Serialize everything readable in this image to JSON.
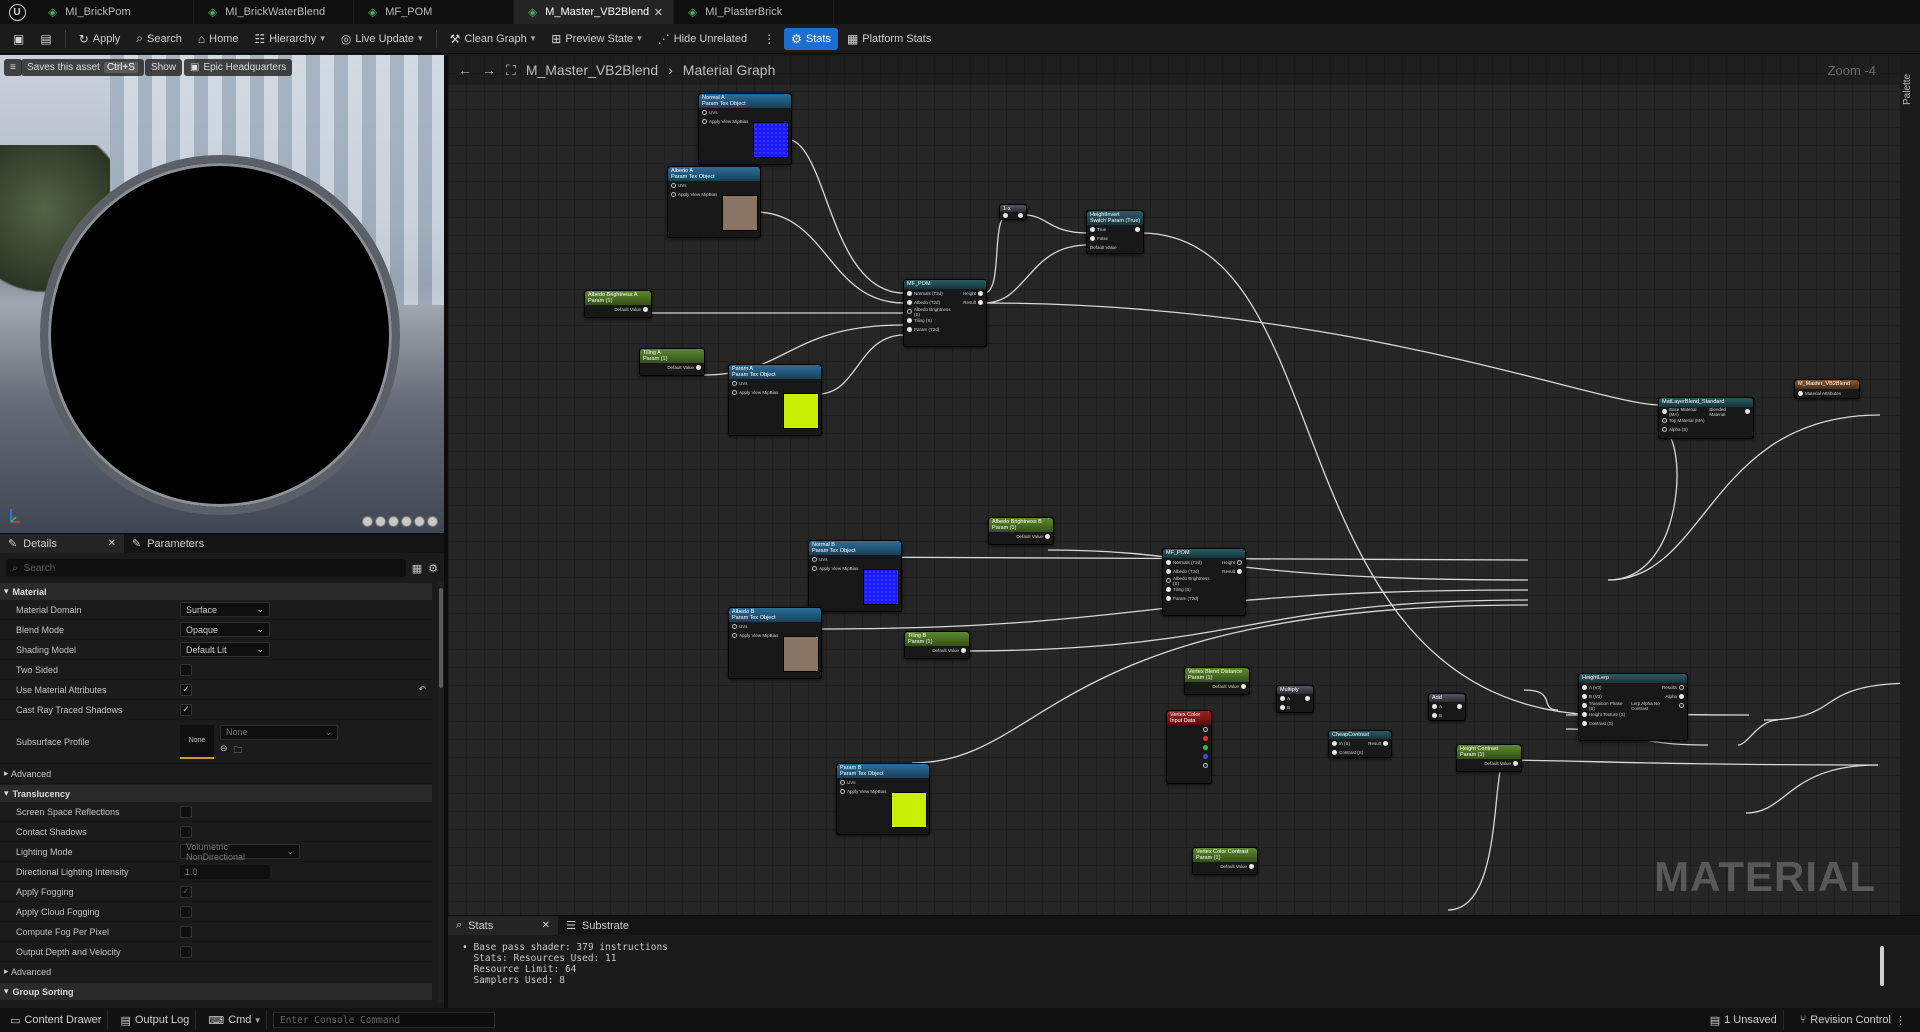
{
  "tabs": [
    {
      "label": "MI_BrickPom",
      "active": false
    },
    {
      "label": "MI_BrickWaterBlend",
      "active": false
    },
    {
      "label": "MF_POM",
      "active": false
    },
    {
      "label": "M_Master_VB2Blend",
      "active": true
    },
    {
      "label": "MI_PlasterBrick",
      "active": false
    }
  ],
  "toolbar": {
    "apply": "Apply",
    "search": "Search",
    "home": "Home",
    "hierarchy": "Hierarchy",
    "live_update": "Live Update",
    "clean_graph": "Clean Graph",
    "preview_state": "Preview State",
    "hide_unrelated": "Hide Unrelated",
    "stats": "Stats",
    "platform_stats": "Platform Stats"
  },
  "viewport": {
    "tooltip": "Saves this asset",
    "shortcut": "Ctrl+S",
    "show": "Show",
    "environment": "Epic Headquarters"
  },
  "details": {
    "tab_details": "Details",
    "tab_parameters": "Parameters",
    "search_placeholder": "Search",
    "cat_material": "Material",
    "material_domain_label": "Material Domain",
    "material_domain_value": "Surface",
    "blend_mode_label": "Blend Mode",
    "blend_mode_value": "Opaque",
    "shading_model_label": "Shading Model",
    "shading_model_value": "Default Lit",
    "two_sided_label": "Two Sided",
    "use_attr_label": "Use Material Attributes",
    "cast_ray_label": "Cast Ray Traced Shadows",
    "subsurface_label": "Subsurface Profile",
    "subsurface_thumb": "None",
    "subsurface_value": "None",
    "advanced1": "Advanced",
    "cat_translucency": "Translucency",
    "ssr_label": "Screen Space Reflections",
    "contact_label": "Contact Shadows",
    "lighting_mode_label": "Lighting Mode",
    "lighting_mode_value": "Volumetric NonDirectional",
    "dir_light_label": "Directional Lighting Intensity",
    "dir_light_value": "1.0",
    "apply_fog_label": "Apply Fogging",
    "cloud_fog_label": "Apply Cloud Fogging",
    "fog_pixel_label": "Compute Fog Per Pixel",
    "output_depth_label": "Output Depth and Velocity",
    "advanced2": "Advanced",
    "cat_group_sorting": "Group Sorting"
  },
  "graph": {
    "title": "M_Master_VB2Blend",
    "subtitle": "Material Graph",
    "zoom": "Zoom -4",
    "watermark": "MATERIAL",
    "palette": "Palette"
  },
  "nodes": {
    "normal_a": {
      "title": "Normal A",
      "sub": "Param Tex Object",
      "p1": "UVs",
      "p2": "Apply View MipBias"
    },
    "albedo_a": {
      "title": "Albedo A",
      "sub": "Param Tex Object",
      "p1": "UVs",
      "p2": "Apply View MipBias"
    },
    "albedo_brightness_a": {
      "title": "Albedo Brightness A",
      "sub": "Param (1)",
      "p1": "Default Value"
    },
    "tiling_a": {
      "title": "Tiling A",
      "sub": "Param (1)",
      "p1": "Default Value"
    },
    "param_a": {
      "title": "Param A",
      "sub": "Param Tex Object",
      "p1": "UVs",
      "p2": "Apply View MipBias"
    },
    "mf_pom_a": {
      "title": "MF_POM",
      "in": [
        "Normals (T2d)",
        "Albedo (T2d)",
        "Albedo Brightness (S)",
        "Tiling (S)",
        "Param (T2d)"
      ],
      "out": [
        "Height",
        "Result"
      ]
    },
    "one_minus": {
      "title": "1-x"
    },
    "height_invert": {
      "title": "HeightInvert",
      "sub": "Switch Param (True)",
      "p1": "True",
      "p2": "False",
      "p3": "Default Value"
    },
    "matlayer": {
      "title": "MatLayerBlend_Standard",
      "in": [
        "Base Material (MA)",
        "Top Material (MA)",
        "Alpha (S)"
      ],
      "out": "Blended Material"
    },
    "result": {
      "title": "M_Master_VB2Blend",
      "p1": "Material Attributes"
    },
    "normal_b": {
      "title": "Normal B",
      "sub": "Param Tex Object",
      "p1": "UVs",
      "p2": "Apply View MipBias"
    },
    "albedo_brightness_b": {
      "title": "Albedo Brightness B",
      "sub": "Param (1)",
      "p1": "Default Value"
    },
    "albedo_b": {
      "title": "Albedo B",
      "sub": "Param Tex Object",
      "p1": "UVs",
      "p2": "Apply View MipBias"
    },
    "tiling_b": {
      "title": "Tiling B",
      "sub": "Param (1)",
      "p1": "Default Value"
    },
    "mf_pom_b": {
      "title": "MF_POM",
      "in": [
        "Normals (T2d)",
        "Albedo (T2d)",
        "Albedo Brightness (S)",
        "Tiling (S)",
        "Param (T2d)"
      ],
      "out": [
        "Height",
        "Result"
      ]
    },
    "vb_distance": {
      "title": "Vertex Blend Distance",
      "sub": "Param (1)",
      "p1": "Default Value"
    },
    "multiply": {
      "title": "Multiply",
      "p1": "A",
      "p2": "B"
    },
    "vertex_color": {
      "title": "Vertex Color",
      "sub": "Input Data"
    },
    "cheap_contrast": {
      "title": "CheapContrast",
      "p1": "In (S)",
      "p2": "Contrast (S)",
      "out": "Result"
    },
    "add": {
      "title": "Add",
      "p1": "A",
      "p2": "B"
    },
    "height_lerp": {
      "title": "HeightLerp",
      "in": [
        "A (V3)",
        "B (V3)",
        "Transition Phase (S)",
        "Height Texture (S)",
        "Contrast (S)"
      ],
      "out": [
        "Results",
        "Alpha",
        "Lerp Alpha No Contrast"
      ]
    },
    "height_contrast": {
      "title": "Height Contrast",
      "sub": "Param (1)",
      "p1": "Default Value"
    },
    "vc_contrast": {
      "title": "Vertex Color Contrast",
      "sub": "Param (1)",
      "p1": "Default Value"
    },
    "param_b": {
      "title": "Param B",
      "sub": "Param Tex Object",
      "p1": "UVs",
      "p2": "Apply View MipBias"
    }
  },
  "stats": {
    "tab_stats": "Stats",
    "tab_substrate": "Substrate",
    "line1": "• Base pass shader: 379 instructions",
    "line2": "  Stats: Resources Used: 11",
    "line3": "  Resource Limit: 64",
    "line4": "  Samplers Used: 8"
  },
  "statusbar": {
    "content_drawer": "Content Drawer",
    "output_log": "Output Log",
    "cmd": "Cmd",
    "console_placeholder": "Enter Console Command",
    "unsaved": "1 Unsaved",
    "revision": "Revision Control"
  }
}
